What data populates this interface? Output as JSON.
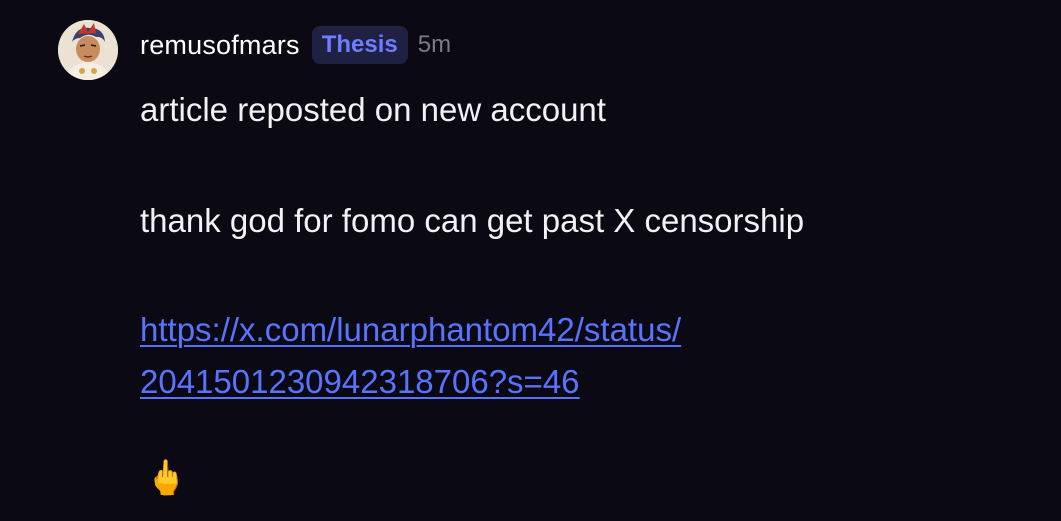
{
  "post": {
    "username": "remusofmars",
    "badge": "Thesis",
    "time": "5m",
    "text_line1": "article reposted on new account",
    "text_line2": "thank god for fomo can get past X censorship",
    "link_part1": "https://x.com/lunarphantom42/status/",
    "link_part2": "2041501230942318706?s=46",
    "emoji": "🖕",
    "avatar_icon": "avatar-illustration"
  },
  "colors": {
    "background": "#0b0a14",
    "badge_bg": "#1f2142",
    "badge_text": "#6e7dff",
    "link": "#5a73ff",
    "muted": "#7b7b86"
  }
}
